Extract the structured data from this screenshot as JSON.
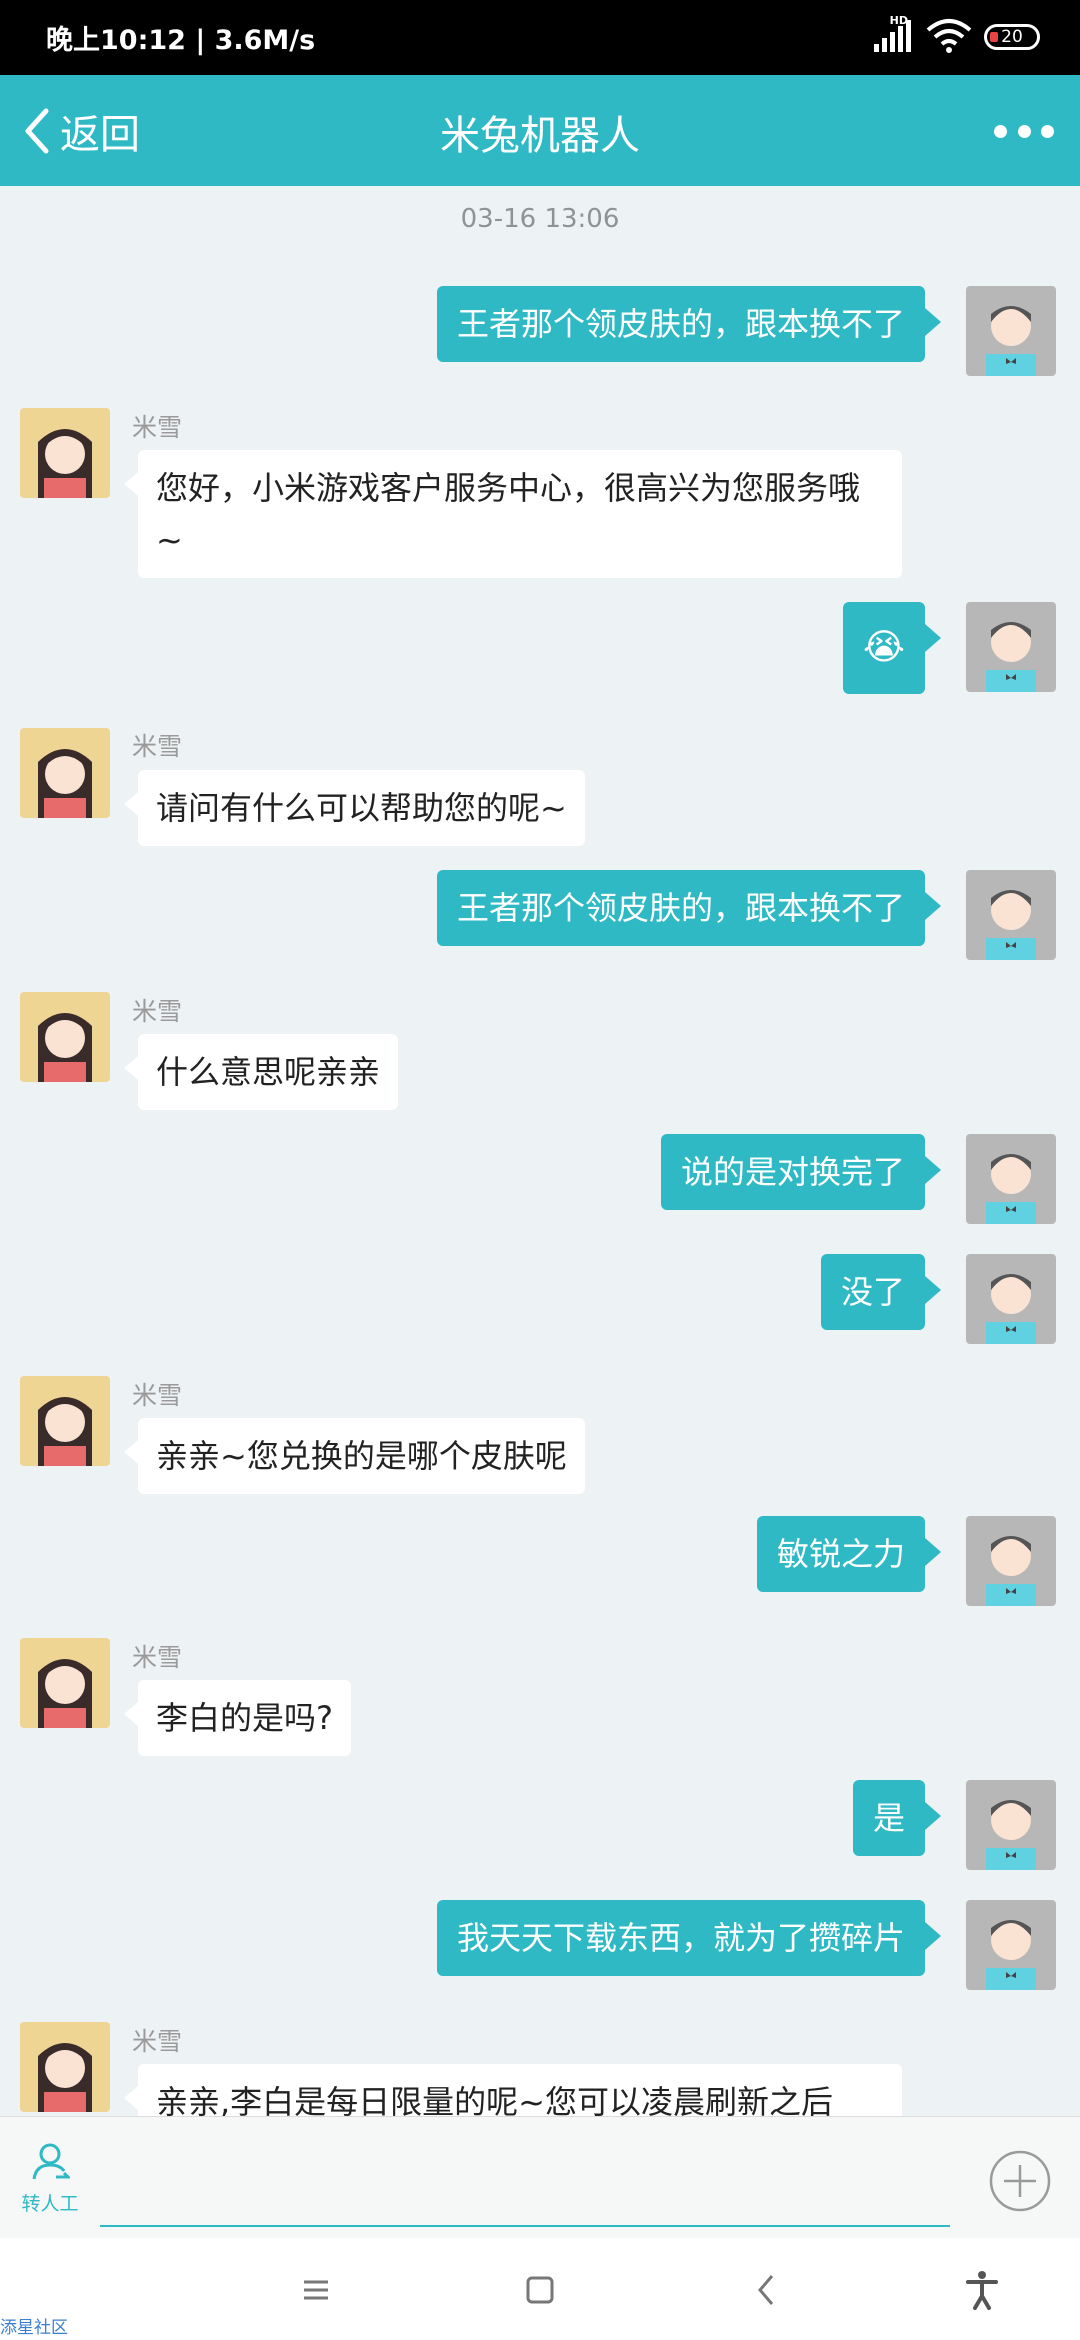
{
  "status_bar": {
    "time": "晚上10:12 | 3.6M/s",
    "network": "HD",
    "battery": "20"
  },
  "header": {
    "back_label": "返回",
    "title": "米兔机器人"
  },
  "chat": {
    "timestamp": "03-16 13:06",
    "bot_name": "米雪",
    "messages": [
      {
        "from": "user",
        "text": "王者那个领皮肤的，跟本换不了"
      },
      {
        "from": "bot",
        "text": "您好，小米游戏客户服务中心，很高兴为您服务哦~"
      },
      {
        "from": "user",
        "text": "😭"
      },
      {
        "from": "bot",
        "text": "请问有什么可以帮助您的呢~"
      },
      {
        "from": "user",
        "text": "王者那个领皮肤的，跟本换不了"
      },
      {
        "from": "bot",
        "text": "什么意思呢亲亲"
      },
      {
        "from": "user",
        "text": "说的是对换完了"
      },
      {
        "from": "user",
        "text": "没了"
      },
      {
        "from": "bot",
        "text": "亲亲~您兑换的是哪个皮肤呢"
      },
      {
        "from": "user",
        "text": "敏锐之力"
      },
      {
        "from": "bot",
        "text": "李白的是吗?"
      },
      {
        "from": "user",
        "text": "是"
      },
      {
        "from": "user",
        "text": "我天天下载东西，就为了攒碎片"
      },
      {
        "from": "bot",
        "text": "亲亲,李白是每日限量的呢~您可以凌晨刷新之后"
      }
    ]
  },
  "input_bar": {
    "transfer_label": "转人工"
  },
  "footer": {
    "watermark": "添星社区"
  },
  "colors": {
    "accent": "#2fb9c5",
    "background": "#edf2f4"
  }
}
